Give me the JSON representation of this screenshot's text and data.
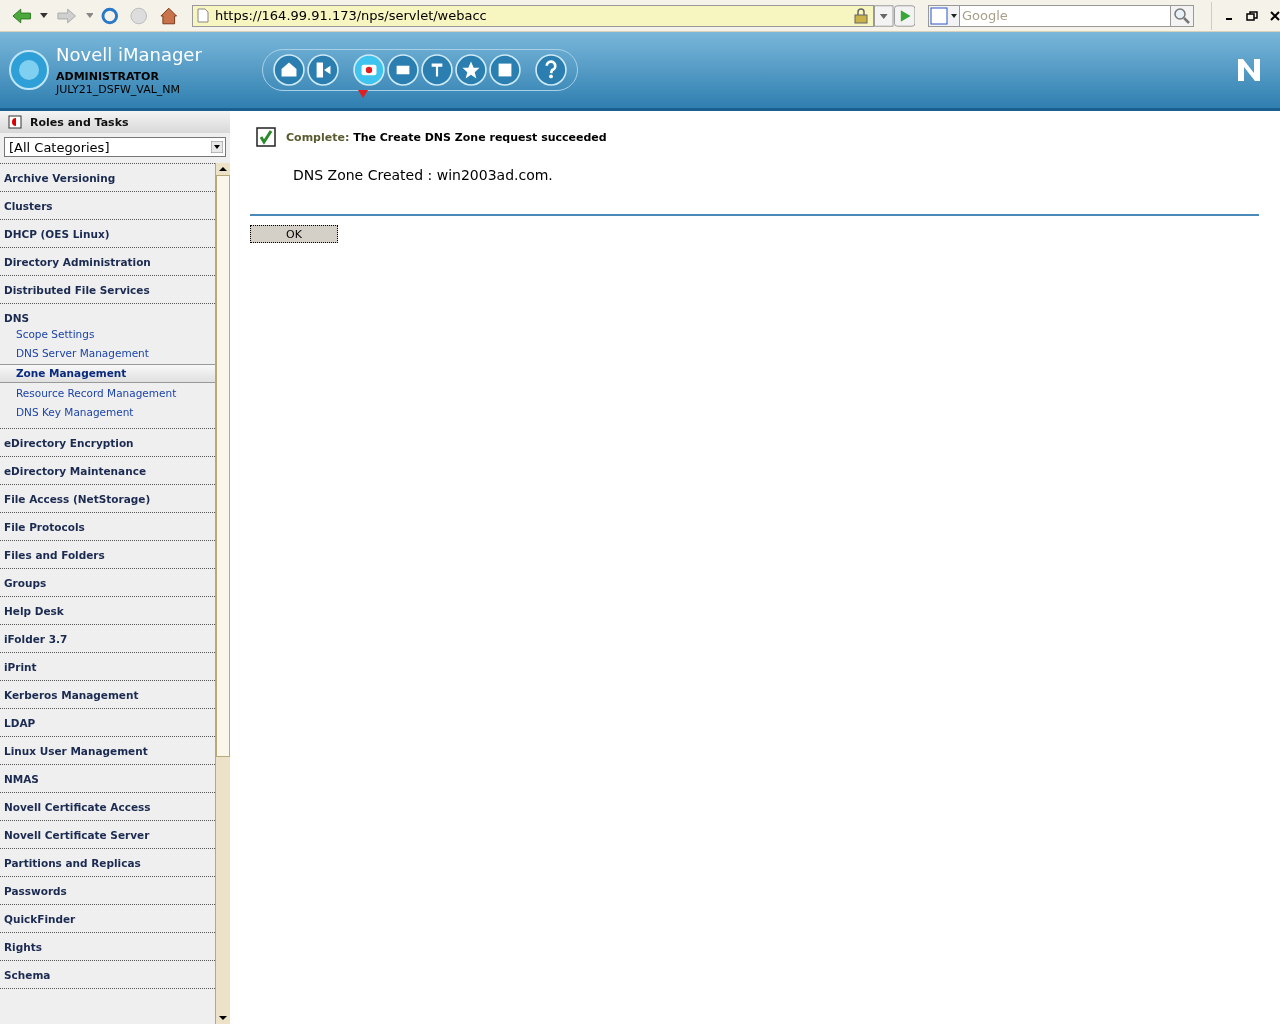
{
  "browser": {
    "url": "https://164.99.91.173/nps/servlet/webacc",
    "search_placeholder": "Google"
  },
  "header": {
    "product": "Novell iManager",
    "user": "ADMINISTRATOR",
    "tree": "JULY21_DSFW_VAL_NM",
    "tools": [
      {
        "kind": "home",
        "selected": false
      },
      {
        "kind": "exit",
        "selected": false
      },
      {
        "kind": "roles",
        "selected": true
      },
      {
        "kind": "view",
        "selected": false
      },
      {
        "kind": "structure",
        "selected": false
      },
      {
        "kind": "favorites",
        "selected": false
      },
      {
        "kind": "tasks",
        "selected": false
      },
      {
        "kind": "help",
        "selected": false
      }
    ]
  },
  "sidebar": {
    "title": "Roles and Tasks",
    "category": "[All Categories]",
    "items": [
      {
        "label": "Archive Versioning",
        "selected": false
      },
      {
        "label": "Clusters",
        "selected": false
      },
      {
        "label": "DHCP (OES Linux)",
        "selected": false
      },
      {
        "label": "Directory Administration",
        "selected": false
      },
      {
        "label": "Distributed File Services",
        "selected": false
      },
      {
        "label": "DNS",
        "selected": false,
        "children": [
          {
            "label": "Scope Settings",
            "selected": false
          },
          {
            "label": "DNS Server Management",
            "selected": false
          },
          {
            "label": "Zone Management",
            "selected": true
          },
          {
            "label": "Resource Record Management",
            "selected": false
          },
          {
            "label": "DNS Key Management",
            "selected": false
          }
        ]
      },
      {
        "label": "eDirectory Encryption",
        "selected": false
      },
      {
        "label": "eDirectory Maintenance",
        "selected": false
      },
      {
        "label": "File Access (NetStorage)",
        "selected": false
      },
      {
        "label": "File Protocols",
        "selected": false
      },
      {
        "label": "Files and Folders",
        "selected": false
      },
      {
        "label": "Groups",
        "selected": false
      },
      {
        "label": "Help Desk",
        "selected": false
      },
      {
        "label": "iFolder 3.7",
        "selected": false
      },
      {
        "label": "iPrint",
        "selected": false
      },
      {
        "label": "Kerberos Management",
        "selected": false
      },
      {
        "label": "LDAP",
        "selected": false
      },
      {
        "label": "Linux User Management",
        "selected": false
      },
      {
        "label": "NMAS",
        "selected": false
      },
      {
        "label": "Novell Certificate Access",
        "selected": false
      },
      {
        "label": "Novell Certificate Server",
        "selected": false
      },
      {
        "label": "Partitions and Replicas",
        "selected": false
      },
      {
        "label": "Passwords",
        "selected": false
      },
      {
        "label": "QuickFinder",
        "selected": false
      },
      {
        "label": "Rights",
        "selected": false
      },
      {
        "label": "Schema",
        "selected": false
      }
    ]
  },
  "content": {
    "status_label": "Complete:",
    "status_text": "The Create DNS Zone request succeeded",
    "detail": "DNS Zone Created : win2003ad.com.",
    "ok_button": "OK"
  }
}
